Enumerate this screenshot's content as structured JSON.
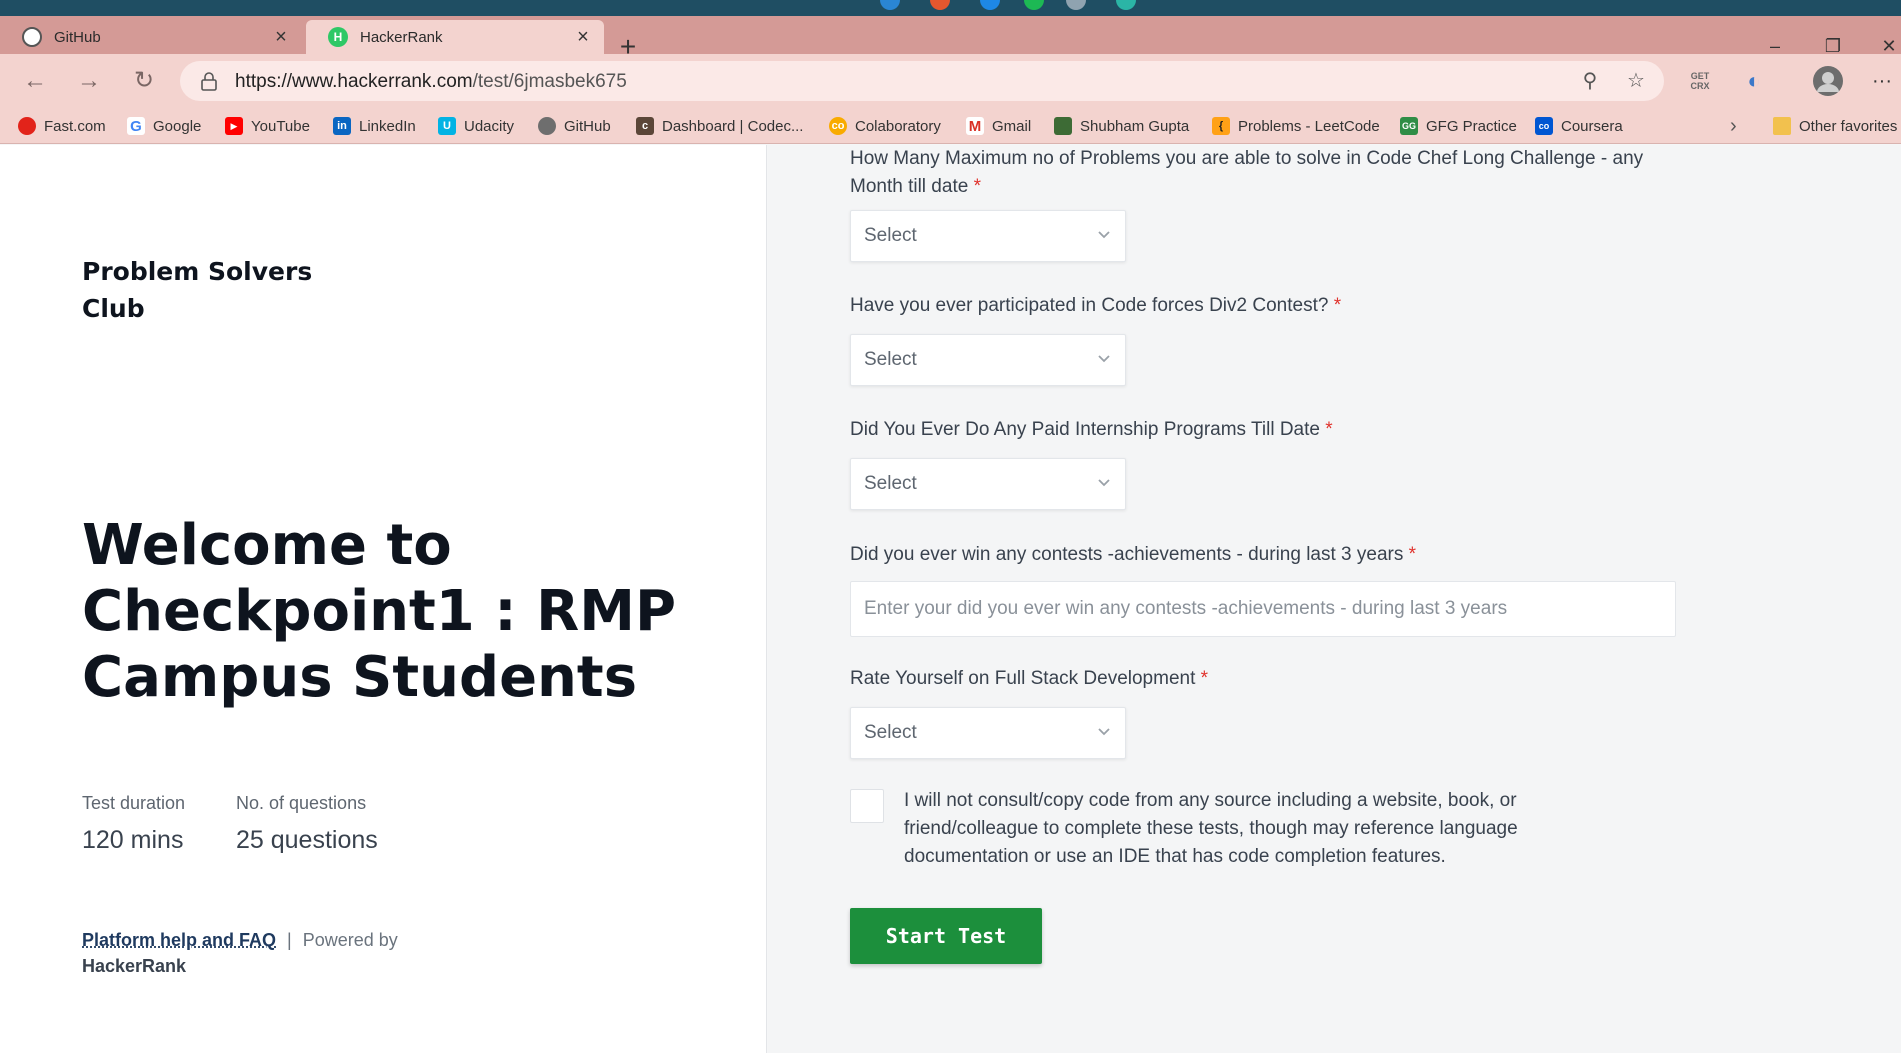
{
  "browser": {
    "tabs": [
      {
        "title": "GitHub",
        "favicon": "github-icon",
        "active": false
      },
      {
        "title": "HackerRank",
        "favicon": "hackerrank-icon",
        "active": true
      }
    ],
    "url_host": "https://www.hackerrank.com",
    "url_path": "/test/6jmasbek675",
    "crx_label": "GET\nCRX",
    "bookmarks": [
      {
        "label": "Fast.com",
        "icon": "fastcom-icon",
        "color": "#e2231a"
      },
      {
        "label": "Google",
        "icon": "google-icon",
        "color": "#4285f4"
      },
      {
        "label": "YouTube",
        "icon": "youtube-icon",
        "color": "#ff0000"
      },
      {
        "label": "LinkedIn",
        "icon": "linkedin-icon",
        "color": "#0a66c2"
      },
      {
        "label": "Udacity",
        "icon": "udacity-icon",
        "color": "#02b3e4"
      },
      {
        "label": "GitHub",
        "icon": "github-icon",
        "color": "#6e6e6e"
      },
      {
        "label": "Dashboard | Codec...",
        "icon": "codechef-icon",
        "color": "#5b4638"
      },
      {
        "label": "Colaboratory",
        "icon": "colab-icon",
        "color": "#f9ab00"
      },
      {
        "label": "Gmail",
        "icon": "gmail-icon",
        "color": "#d93025"
      },
      {
        "label": "Shubham Gupta",
        "icon": "profile-icon",
        "color": "#3d6b35"
      },
      {
        "label": "Problems - LeetCode",
        "icon": "leetcode-icon",
        "color": "#ffa116"
      },
      {
        "label": "GFG Practice",
        "icon": "gfg-icon",
        "color": "#2f8d46"
      },
      {
        "label": "Coursera",
        "icon": "coursera-icon",
        "color": "#0056d2"
      }
    ],
    "other_favorites": "Other favorites"
  },
  "left": {
    "club_name": "Problem Solvers Club",
    "welcome_title": "Welcome to Checkpoint1 : RMP Campus Students",
    "duration_label": "Test duration",
    "duration_value": "120 mins",
    "questions_label": "No. of questions",
    "questions_value": "25 questions",
    "help_link": "Platform help and FAQ",
    "separator": "|",
    "powered_by": "Powered by",
    "brand": "HackerRank"
  },
  "form": {
    "questions": [
      {
        "label": "How Many Maximum no of Problems you are able to solve in Code Chef Long Challenge - any Month till date",
        "required": "*",
        "value": "Select"
      },
      {
        "label": "Have you ever participated in Code forces Div2 Contest?",
        "required": "*",
        "value": "Select"
      },
      {
        "label": "Did You Ever Do Any Paid Internship Programs Till Date",
        "required": "*",
        "value": "Select"
      },
      {
        "label": "Did you ever win any contests -achievements - during last 3 years",
        "required": "*",
        "placeholder": "Enter your did you ever win any contests -achievements - during last 3 years"
      },
      {
        "label": "Rate Yourself on Full Stack Development",
        "required": "*",
        "value": "Select"
      }
    ],
    "agreement": "I will not consult/copy code from any source including a website, book, or friend/colleague to complete these tests, though may reference language documentation or use an IDE that has code completion features.",
    "start_button": "Start Test"
  },
  "colors": {
    "start_button": "#1c8f3c",
    "required": "#e0332d",
    "browser_frame": "#d49a96"
  }
}
